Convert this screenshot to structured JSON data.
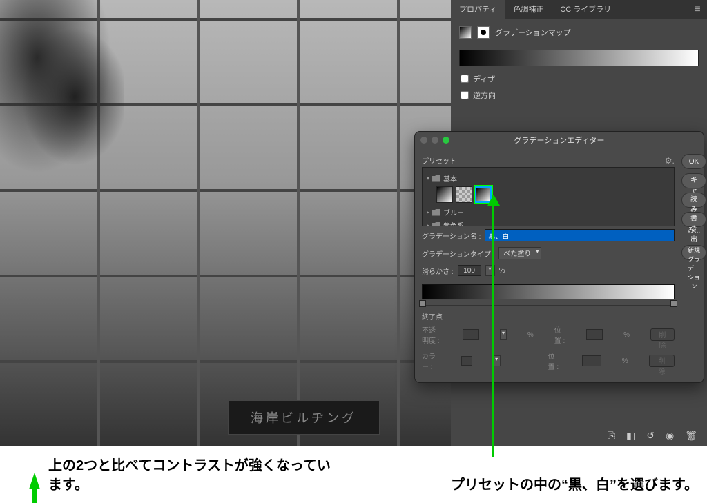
{
  "image": {
    "sign_text": "海岸ビルヂング"
  },
  "panel": {
    "tabs": [
      "プロパティ",
      "色調補正",
      "CC ライブラリ"
    ],
    "adjustment_title": "グラデーションマップ",
    "checks": {
      "dither": "ディザ",
      "reverse": "逆方向"
    }
  },
  "dialog": {
    "title": "グラデーションエディター",
    "preset_label": "プリセット",
    "folders": {
      "basic": "基本",
      "blue": "ブルー",
      "purple": "紫色系"
    },
    "buttons": {
      "ok": "OK",
      "cancel": "キャンセル",
      "load": "読み込み...",
      "save": "書き出し...",
      "new_grad": "新規グラデーション"
    },
    "name_label": "グラデーション名 :",
    "name_value": "黒、白",
    "type_label": "グラデーションタイプ :",
    "type_value": "べた塗り",
    "smooth_label": "滑らかさ :",
    "smooth_value": "100",
    "smooth_unit": "%",
    "endpoint_label": "終了点",
    "stops": {
      "opacity_label": "不透明度 :",
      "opacity_unit": "%",
      "color_label": "カラー :",
      "pos_label": "位置 :",
      "pos_unit": "%",
      "delete": "削除"
    }
  },
  "icons": {
    "reset": "↺",
    "adj": "◧",
    "mask": "◯",
    "eye": "◉",
    "trash": "🗑"
  },
  "annotations": {
    "left": "上の2つと比べてコントラストが強くなっています。",
    "right": "プリセットの中の“黒、白”を選びます。"
  }
}
